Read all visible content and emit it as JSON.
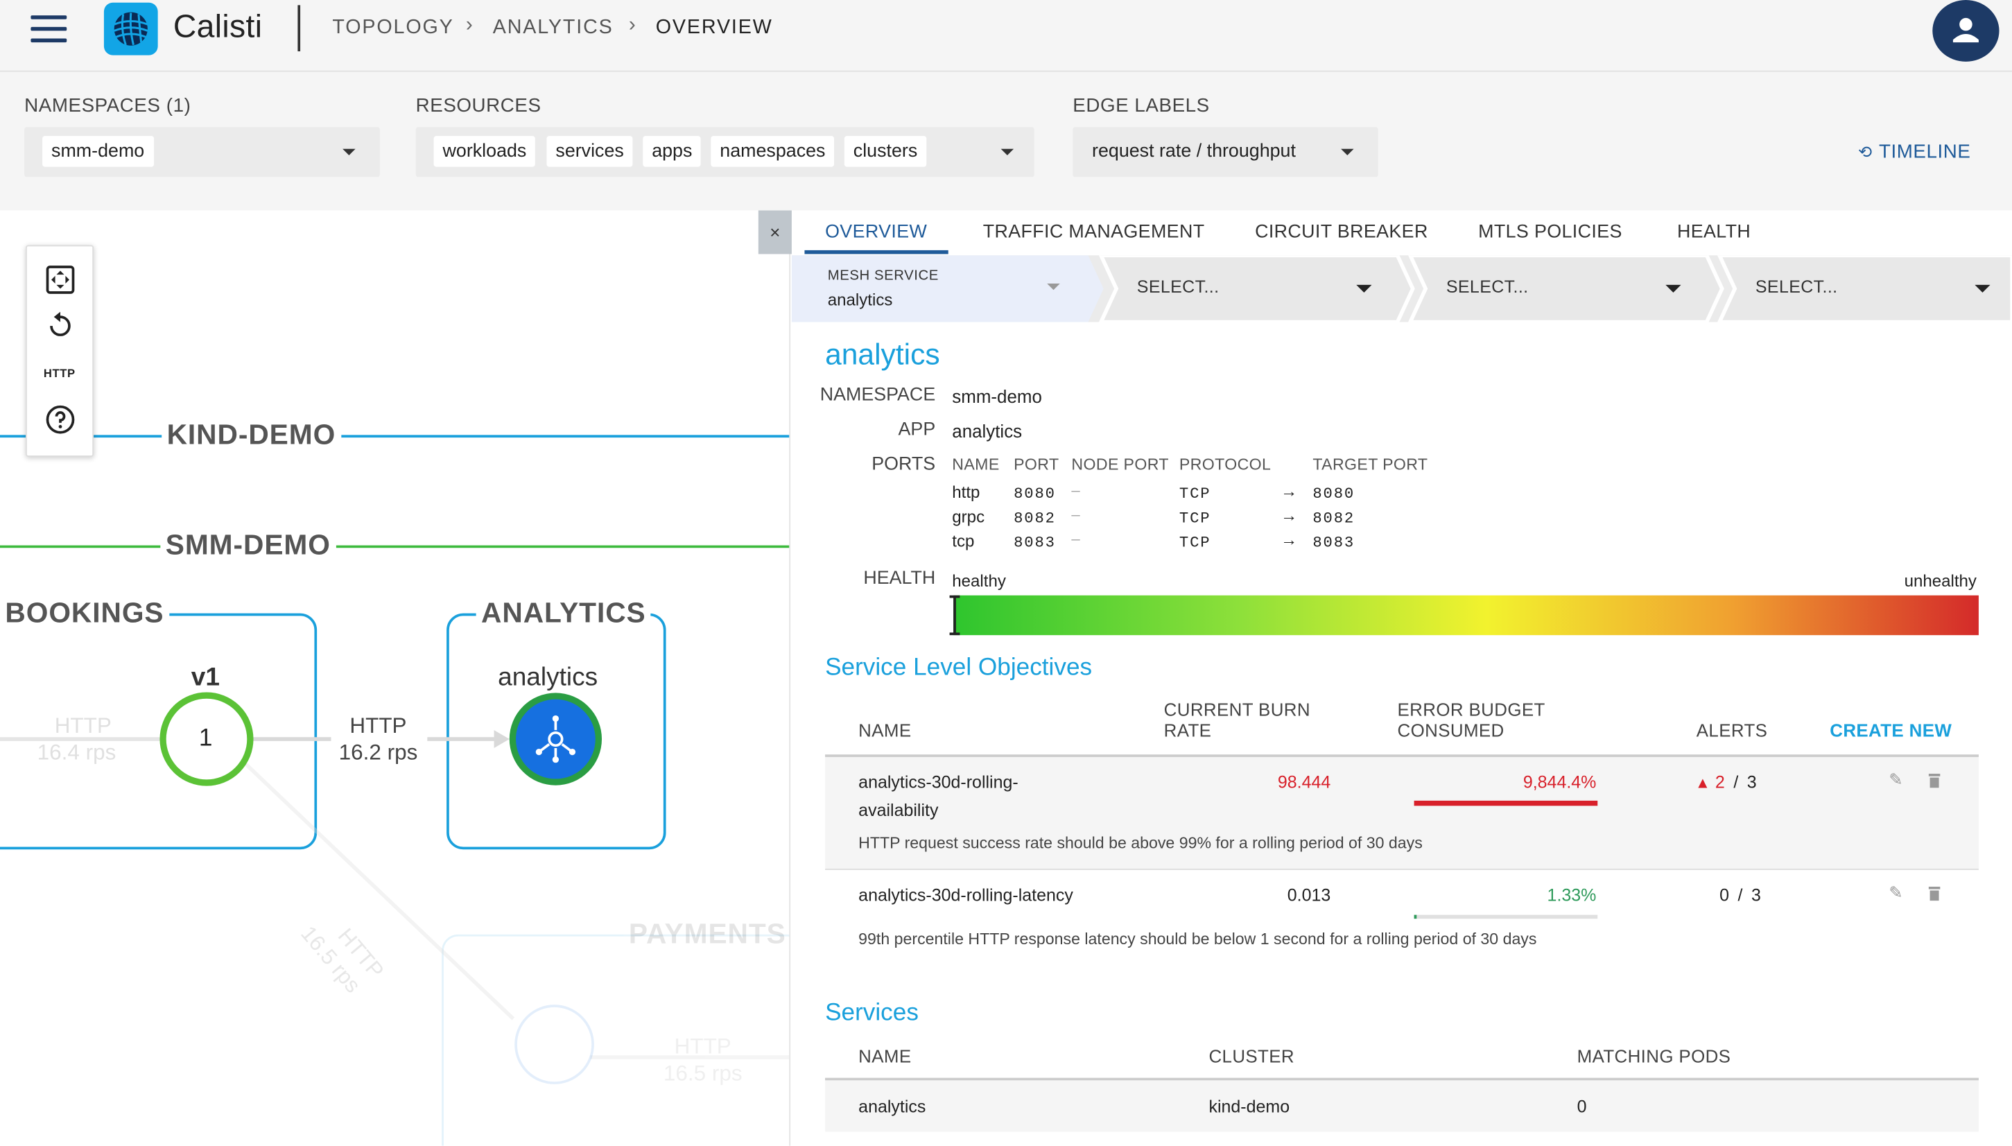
{
  "header": {
    "app_name": "Calisti",
    "breadcrumb": [
      "TOPOLOGY",
      "ANALYTICS",
      "OVERVIEW"
    ],
    "separator": "›"
  },
  "filters": {
    "namespaces": {
      "label": "NAMESPACES (1)",
      "value": "smm-demo"
    },
    "resources": {
      "label": "RESOURCES",
      "chips": [
        "workloads",
        "services",
        "apps",
        "namespaces",
        "clusters"
      ]
    },
    "edge_labels": {
      "label": "EDGE LABELS",
      "value": "request rate / throughput"
    },
    "timeline": "TIMELINE"
  },
  "canvas": {
    "toolbar": {
      "http_label": "HTTP"
    },
    "clusters": [
      "KIND-DEMO",
      "SMM-DEMO"
    ],
    "groups": {
      "bookings": "BOOKINGS",
      "analytics": "ANALYTICS",
      "payments": "PAYMENTS"
    },
    "nodes": {
      "v1": "v1",
      "v1_count": "1",
      "analytics": "analytics"
    },
    "edges": [
      {
        "proto": "HTTP",
        "rate": "16.4 rps"
      },
      {
        "proto": "HTTP",
        "rate": "16.2 rps"
      },
      {
        "proto": "HTTP",
        "rate": "16.5 rps"
      },
      {
        "proto": "HTTP",
        "rate": "16.5 rps"
      }
    ],
    "close": "×"
  },
  "panel": {
    "tabs": [
      "OVERVIEW",
      "TRAFFIC MANAGEMENT",
      "CIRCUIT BREAKER",
      "MTLS POLICIES",
      "HEALTH"
    ],
    "selectors": [
      {
        "label": "MESH SERVICE",
        "value": "analytics"
      },
      {
        "value": "SELECT..."
      },
      {
        "value": "SELECT..."
      },
      {
        "value": "SELECT..."
      }
    ],
    "service": {
      "title": "analytics",
      "namespace_label": "NAMESPACE",
      "namespace": "smm-demo",
      "app_label": "APP",
      "app": "analytics",
      "ports_label": "PORTS",
      "port_headers": [
        "NAME",
        "PORT",
        "NODE PORT",
        "PROTOCOL",
        "TARGET PORT"
      ],
      "ports": [
        {
          "name": "http",
          "port": "8080",
          "node_port": "–",
          "protocol": "TCP",
          "target": "8080"
        },
        {
          "name": "grpc",
          "port": "8082",
          "node_port": "–",
          "protocol": "TCP",
          "target": "8082"
        },
        {
          "name": "tcp",
          "port": "8083",
          "node_port": "–",
          "protocol": "TCP",
          "target": "8083"
        }
      ],
      "health_label": "HEALTH",
      "health_left": "healthy",
      "health_right": "unhealthy",
      "health_level": 0.0
    },
    "slo": {
      "title": "Service Level Objectives",
      "headers": {
        "name": "NAME",
        "burn": "CURRENT BURN\nRATE",
        "budget": "ERROR BUDGET\nCONSUMED",
        "alerts": "ALERTS",
        "create": "CREATE NEW"
      },
      "rows": [
        {
          "name_1": "analytics-30d-rolling-",
          "name_2": "availability",
          "burn": "98.444",
          "budget": "9,844.4%",
          "budget_fraction": 1.0,
          "alerts_firing": "2",
          "alerts_sep": "/",
          "alerts_total": "3",
          "desc": "HTTP request success rate should be above 99% for a rolling period of 30 days",
          "color": "#d8202a"
        },
        {
          "name_1": "analytics-30d-rolling-latency",
          "burn": "0.013",
          "budget": "1.33%",
          "budget_fraction": 0.0133,
          "alerts_firing": "0",
          "alerts_sep": "/",
          "alerts_total": "3",
          "desc": "99th percentile HTTP response latency should be below 1 second for a rolling period of 30 days",
          "color": "#2e9a5a"
        }
      ]
    },
    "services": {
      "title": "Services",
      "headers": [
        "NAME",
        "CLUSTER",
        "MATCHING PODS"
      ],
      "rows": [
        {
          "name": "analytics",
          "cluster": "kind-demo",
          "pods": "0"
        }
      ]
    }
  },
  "colors": {
    "accent": "#1aa0dc",
    "nav": "#1d3a66",
    "link": "#1e5a99",
    "cluster_line": "#1aa0dc",
    "namespace_line": "#3dba3d"
  }
}
